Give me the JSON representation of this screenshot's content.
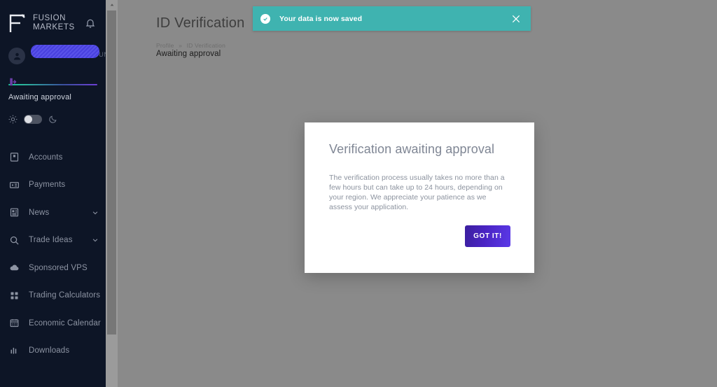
{
  "brand": {
    "line1": "FUSION",
    "line2": "MARKETS",
    "logo_icon": "fusion-f-logo",
    "bell_icon": "bell-icon"
  },
  "profile": {
    "avatar_icon": "user-avatar-icon",
    "name_redacted": "",
    "account_type": "TEMPORARY ACCOUNT",
    "logout_icon": "logout-icon"
  },
  "status": {
    "progress_label": "Awaiting approval",
    "progress_start_color": "#19c29a",
    "progress_end_color": "#6d3fd6"
  },
  "theme": {
    "light_icon": "sun-icon",
    "dark_icon": "moon-icon",
    "toggle_state": "light"
  },
  "sidebar": {
    "items": [
      {
        "label": "Accounts",
        "icon": "accounts-icon",
        "chevron": false
      },
      {
        "label": "Payments",
        "icon": "payments-card-icon",
        "chevron": false
      },
      {
        "label": "News",
        "icon": "news-icon",
        "chevron": true
      },
      {
        "label": "Trade Ideas",
        "icon": "search-icon",
        "chevron": true
      },
      {
        "label": "Sponsored VPS",
        "icon": "cloud-icon",
        "chevron": false
      },
      {
        "label": "Trading Calculators",
        "icon": "calculator-icon",
        "chevron": false
      },
      {
        "label": "Economic Calendar",
        "icon": "calendar-icon",
        "chevron": false
      },
      {
        "label": "Downloads",
        "icon": "downloads-bars-icon",
        "chevron": false
      }
    ]
  },
  "scrollbar": {
    "up_arrow_icon": "chevron-up-icon"
  },
  "page": {
    "title": "ID Verification",
    "breadcrumb_parent": "Profile",
    "breadcrumb_separator": "»",
    "breadcrumb_current": "ID Verification",
    "status_text": "Awaiting approval"
  },
  "toast": {
    "message": "Your data is now saved",
    "icon": "check-circle-icon",
    "close_icon": "close-icon",
    "background_color": "#3fb3b0"
  },
  "modal": {
    "title": "Verification awaiting approval",
    "body": "The verification process usually takes no more than a few hours but can take up to 24 hours, depending on your region. We appreciate your patience as we assess your application.",
    "button_label": "GOT IT!",
    "button_color": "#4a24c4"
  }
}
